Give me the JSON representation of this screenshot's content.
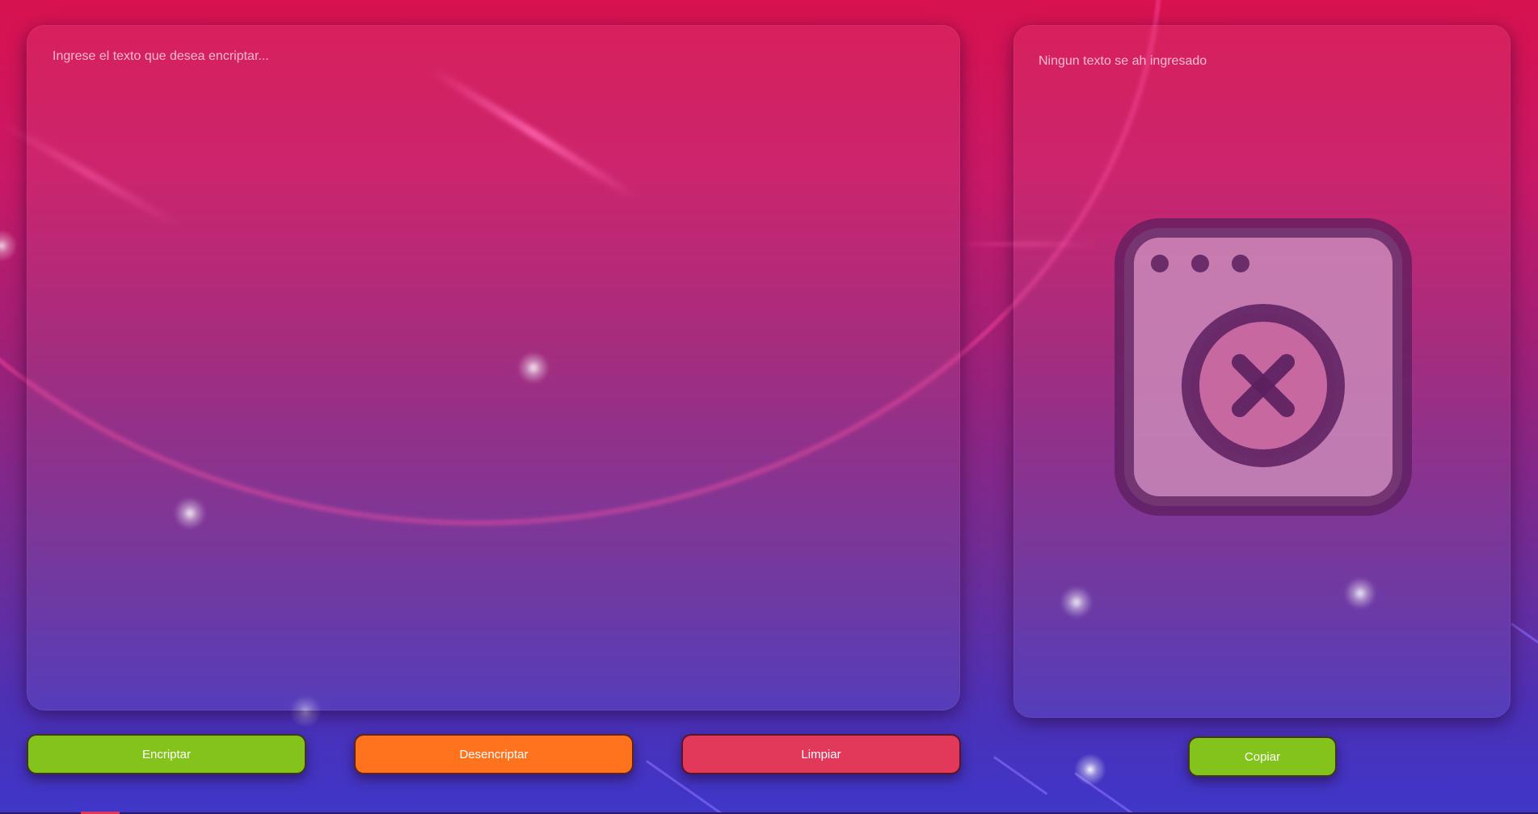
{
  "input": {
    "placeholder": "Ingrese el texto que desea encriptar...",
    "value": ""
  },
  "output": {
    "empty_message": "Ningun texto se ah ingresado",
    "illustration_icon": "empty-window-x-icon"
  },
  "actions": {
    "encrypt_label": "Encriptar",
    "decrypt_label": "Desencriptar",
    "clear_label": "Limpiar",
    "copy_label": "Copiar"
  },
  "colors": {
    "encrypt": "#84c31b",
    "decrypt": "#ff731f",
    "clear": "#e2385a",
    "copy": "#84c31b"
  }
}
